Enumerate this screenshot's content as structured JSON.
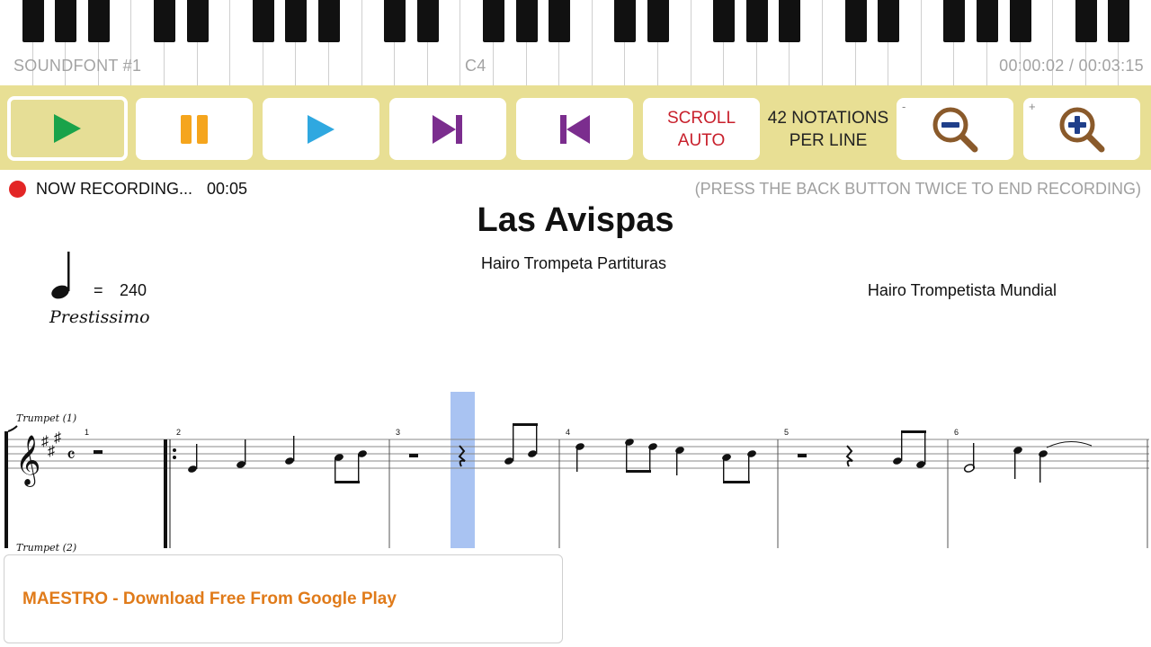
{
  "keyboard": {
    "soundfont": "SOUNDFONT #1",
    "note": "C4",
    "time": "00:00:02 / 00:03:15"
  },
  "toolbar": {
    "play_icon": "play-icon",
    "pause_icon": "pause-icon",
    "play_alt_icon": "play-icon",
    "next_icon": "skip-next-icon",
    "prev_icon": "skip-previous-icon",
    "scroll_line1": "SCROLL",
    "scroll_line2": "AUTO",
    "notations_line1": "42 NOTATIONS",
    "notations_line2": "PER LINE",
    "zoom_out_sign": "-",
    "zoom_in_sign": "+",
    "colors": {
      "bar": "#e8df94",
      "play": "#1aa34a",
      "pause": "#f5a51d",
      "play_alt": "#2fa8e0",
      "skip": "#7b2d8e",
      "scroll": "#c8202c",
      "zoom_ring": "#8a5a2b",
      "zoom_sign": "#1f3f8a"
    }
  },
  "recording": {
    "label": "NOW RECORDING...",
    "elapsed": "00:05",
    "hint": "(PRESS THE BACK BUTTON TWICE TO END RECORDING)"
  },
  "score": {
    "title": "Las Avispas",
    "subtitle": "Hairo Trompeta Partituras",
    "composer": "Hairo Trompetista Mundial",
    "tempo_eq": "=",
    "tempo_value": "240",
    "tempo_marking": "Prestissimo",
    "instrument_1": "Trumpet (1)",
    "instrument_2": "Trumpet (2)",
    "measures": [
      "1",
      "2",
      "3",
      "4",
      "5",
      "6"
    ]
  },
  "ad": {
    "text": "MAESTRO - Download Free From Google Play"
  }
}
